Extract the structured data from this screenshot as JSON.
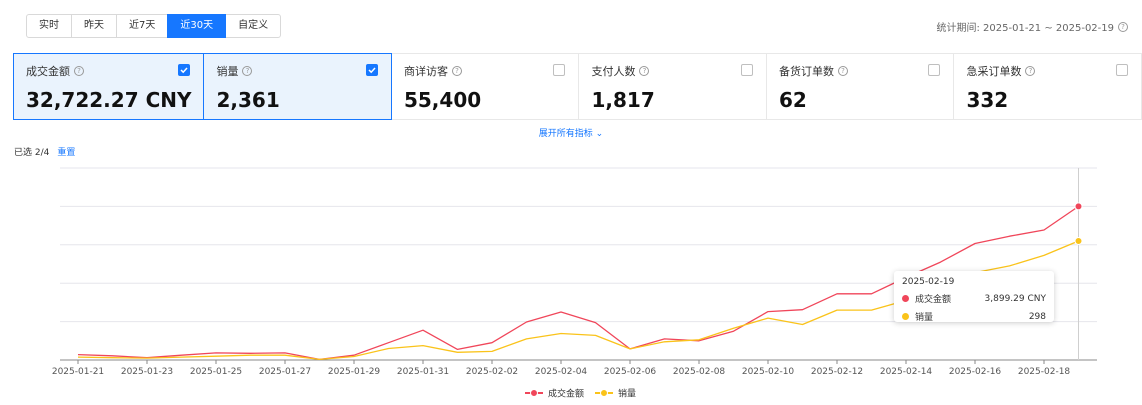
{
  "toolbar": {
    "ranges": [
      "实时",
      "昨天",
      "近7天",
      "近30天",
      "自定义"
    ],
    "active_index": 3
  },
  "period": {
    "label": "统计期间: 2025-01-21 ~ 2025-02-19"
  },
  "metrics": [
    {
      "label": "成交金额",
      "value": "32,722.27 CNY",
      "selected": true
    },
    {
      "label": "销量",
      "value": "2,361",
      "selected": true
    },
    {
      "label": "商详访客",
      "value": "55,400",
      "selected": false
    },
    {
      "label": "支付人数",
      "value": "1,817",
      "selected": false
    },
    {
      "label": "备货订单数",
      "value": "62",
      "selected": false
    },
    {
      "label": "急采订单数",
      "value": "332",
      "selected": false
    }
  ],
  "expand_label": "展开所有指标",
  "selection": {
    "count_text": "已选 2/4",
    "clear_label": "重置"
  },
  "colors": {
    "accent": "#1677ff",
    "series_amount": "#f0465a",
    "series_volume": "#fac31a"
  },
  "chart_data": {
    "type": "line",
    "x": [
      "2025-01-21",
      "2025-01-22",
      "2025-01-23",
      "2025-01-24",
      "2025-01-25",
      "2025-01-26",
      "2025-01-27",
      "2025-01-28",
      "2025-01-29",
      "2025-01-30",
      "2025-01-31",
      "2025-02-01",
      "2025-02-02",
      "2025-02-03",
      "2025-02-04",
      "2025-02-05",
      "2025-02-06",
      "2025-02-07",
      "2025-02-08",
      "2025-02-09",
      "2025-02-10",
      "2025-02-11",
      "2025-02-12",
      "2025-02-13",
      "2025-02-14",
      "2025-02-15",
      "2025-02-16",
      "2025-02-17",
      "2025-02-18",
      "2025-02-19"
    ],
    "x_tick_labels": [
      "2025-01-21",
      "2025-01-23",
      "2025-01-25",
      "2025-01-27",
      "2025-01-29",
      "2025-01-31",
      "2025-02-02",
      "2025-02-04",
      "2025-02-06",
      "2025-02-08",
      "2025-02-10",
      "2025-02-12",
      "2025-02-14",
      "2025-02-16",
      "2025-02-18"
    ],
    "series": [
      {
        "name": "成交金额",
        "values": [
          0.028,
          0.022,
          0.012,
          0.025,
          0.037,
          0.035,
          0.037,
          0.003,
          0.025,
          0.09,
          0.155,
          0.055,
          0.09,
          0.198,
          0.25,
          0.195,
          0.058,
          0.11,
          0.1,
          0.15,
          0.252,
          0.262,
          0.345,
          0.345,
          0.43,
          0.51,
          0.607,
          0.645,
          0.677,
          0.8
        ]
      },
      {
        "name": "销量",
        "values": [
          0.015,
          0.012,
          0.01,
          0.015,
          0.02,
          0.025,
          0.025,
          0.003,
          0.018,
          0.06,
          0.075,
          0.04,
          0.045,
          0.11,
          0.138,
          0.128,
          0.058,
          0.095,
          0.105,
          0.165,
          0.218,
          0.185,
          0.26,
          0.26,
          0.31,
          0.38,
          0.455,
          0.49,
          0.545,
          0.62
        ]
      }
    ],
    "ylim": [
      0,
      1
    ],
    "grid": true,
    "legend": "bottom-center",
    "tooltip": {
      "date": "2025-02-19",
      "rows": [
        {
          "name": "成交金额",
          "value": "3,899.29 CNY"
        },
        {
          "name": "销量",
          "value": "298"
        }
      ]
    }
  }
}
